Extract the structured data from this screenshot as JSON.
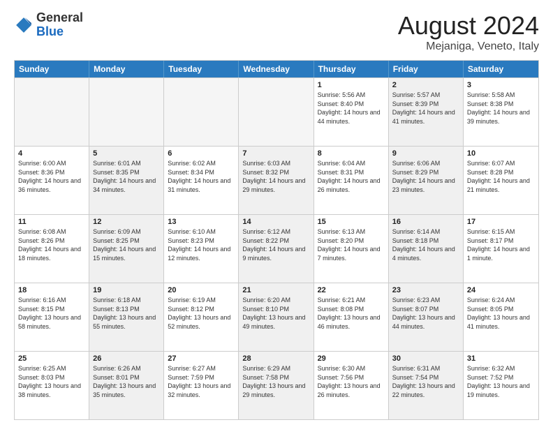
{
  "logo": {
    "general": "General",
    "blue": "Blue"
  },
  "title": {
    "month": "August 2024",
    "location": "Mejaniga, Veneto, Italy"
  },
  "header_days": [
    "Sunday",
    "Monday",
    "Tuesday",
    "Wednesday",
    "Thursday",
    "Friday",
    "Saturday"
  ],
  "rows": [
    [
      {
        "day": "",
        "info": "",
        "empty": true
      },
      {
        "day": "",
        "info": "",
        "empty": true
      },
      {
        "day": "",
        "info": "",
        "empty": true
      },
      {
        "day": "",
        "info": "",
        "empty": true
      },
      {
        "day": "1",
        "info": "Sunrise: 5:56 AM\nSunset: 8:40 PM\nDaylight: 14 hours and 44 minutes."
      },
      {
        "day": "2",
        "info": "Sunrise: 5:57 AM\nSunset: 8:39 PM\nDaylight: 14 hours and 41 minutes.",
        "shaded": true
      },
      {
        "day": "3",
        "info": "Sunrise: 5:58 AM\nSunset: 8:38 PM\nDaylight: 14 hours and 39 minutes."
      }
    ],
    [
      {
        "day": "4",
        "info": "Sunrise: 6:00 AM\nSunset: 8:36 PM\nDaylight: 14 hours and 36 minutes."
      },
      {
        "day": "5",
        "info": "Sunrise: 6:01 AM\nSunset: 8:35 PM\nDaylight: 14 hours and 34 minutes.",
        "shaded": true
      },
      {
        "day": "6",
        "info": "Sunrise: 6:02 AM\nSunset: 8:34 PM\nDaylight: 14 hours and 31 minutes."
      },
      {
        "day": "7",
        "info": "Sunrise: 6:03 AM\nSunset: 8:32 PM\nDaylight: 14 hours and 29 minutes.",
        "shaded": true
      },
      {
        "day": "8",
        "info": "Sunrise: 6:04 AM\nSunset: 8:31 PM\nDaylight: 14 hours and 26 minutes."
      },
      {
        "day": "9",
        "info": "Sunrise: 6:06 AM\nSunset: 8:29 PM\nDaylight: 14 hours and 23 minutes.",
        "shaded": true
      },
      {
        "day": "10",
        "info": "Sunrise: 6:07 AM\nSunset: 8:28 PM\nDaylight: 14 hours and 21 minutes."
      }
    ],
    [
      {
        "day": "11",
        "info": "Sunrise: 6:08 AM\nSunset: 8:26 PM\nDaylight: 14 hours and 18 minutes."
      },
      {
        "day": "12",
        "info": "Sunrise: 6:09 AM\nSunset: 8:25 PM\nDaylight: 14 hours and 15 minutes.",
        "shaded": true
      },
      {
        "day": "13",
        "info": "Sunrise: 6:10 AM\nSunset: 8:23 PM\nDaylight: 14 hours and 12 minutes."
      },
      {
        "day": "14",
        "info": "Sunrise: 6:12 AM\nSunset: 8:22 PM\nDaylight: 14 hours and 9 minutes.",
        "shaded": true
      },
      {
        "day": "15",
        "info": "Sunrise: 6:13 AM\nSunset: 8:20 PM\nDaylight: 14 hours and 7 minutes."
      },
      {
        "day": "16",
        "info": "Sunrise: 6:14 AM\nSunset: 8:18 PM\nDaylight: 14 hours and 4 minutes.",
        "shaded": true
      },
      {
        "day": "17",
        "info": "Sunrise: 6:15 AM\nSunset: 8:17 PM\nDaylight: 14 hours and 1 minute."
      }
    ],
    [
      {
        "day": "18",
        "info": "Sunrise: 6:16 AM\nSunset: 8:15 PM\nDaylight: 13 hours and 58 minutes."
      },
      {
        "day": "19",
        "info": "Sunrise: 6:18 AM\nSunset: 8:13 PM\nDaylight: 13 hours and 55 minutes.",
        "shaded": true
      },
      {
        "day": "20",
        "info": "Sunrise: 6:19 AM\nSunset: 8:12 PM\nDaylight: 13 hours and 52 minutes."
      },
      {
        "day": "21",
        "info": "Sunrise: 6:20 AM\nSunset: 8:10 PM\nDaylight: 13 hours and 49 minutes.",
        "shaded": true
      },
      {
        "day": "22",
        "info": "Sunrise: 6:21 AM\nSunset: 8:08 PM\nDaylight: 13 hours and 46 minutes."
      },
      {
        "day": "23",
        "info": "Sunrise: 6:23 AM\nSunset: 8:07 PM\nDaylight: 13 hours and 44 minutes.",
        "shaded": true
      },
      {
        "day": "24",
        "info": "Sunrise: 6:24 AM\nSunset: 8:05 PM\nDaylight: 13 hours and 41 minutes."
      }
    ],
    [
      {
        "day": "25",
        "info": "Sunrise: 6:25 AM\nSunset: 8:03 PM\nDaylight: 13 hours and 38 minutes."
      },
      {
        "day": "26",
        "info": "Sunrise: 6:26 AM\nSunset: 8:01 PM\nDaylight: 13 hours and 35 minutes.",
        "shaded": true
      },
      {
        "day": "27",
        "info": "Sunrise: 6:27 AM\nSunset: 7:59 PM\nDaylight: 13 hours and 32 minutes."
      },
      {
        "day": "28",
        "info": "Sunrise: 6:29 AM\nSunset: 7:58 PM\nDaylight: 13 hours and 29 minutes.",
        "shaded": true
      },
      {
        "day": "29",
        "info": "Sunrise: 6:30 AM\nSunset: 7:56 PM\nDaylight: 13 hours and 26 minutes."
      },
      {
        "day": "30",
        "info": "Sunrise: 6:31 AM\nSunset: 7:54 PM\nDaylight: 13 hours and 22 minutes.",
        "shaded": true
      },
      {
        "day": "31",
        "info": "Sunrise: 6:32 AM\nSunset: 7:52 PM\nDaylight: 13 hours and 19 minutes."
      }
    ]
  ]
}
